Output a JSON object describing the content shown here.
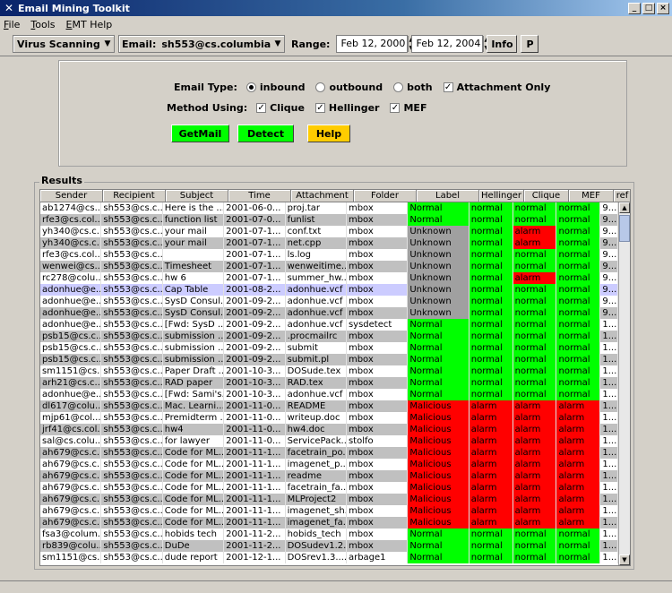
{
  "window": {
    "title": "Email Mining Toolkit"
  },
  "menu": [
    {
      "label": "File",
      "u": "F",
      "rest": "ile"
    },
    {
      "label": "Tools",
      "u": "T",
      "rest": "ools"
    },
    {
      "label": "EMT Help",
      "u": "E",
      "rest": "MT Help"
    }
  ],
  "toolbar": {
    "mode": "Virus Scanning",
    "email_label": "Email:",
    "email": "sh553@cs.columbia.edu",
    "range_label": "Range:",
    "range_start": "Feb 12, 2000",
    "range_end": "Feb 12, 2004",
    "info_label": "Info",
    "p_label": "P"
  },
  "controls": {
    "email_type_label": "Email Type:",
    "email_type_options": [
      {
        "label": "inbound",
        "selected": true
      },
      {
        "label": "outbound",
        "selected": false
      },
      {
        "label": "both",
        "selected": false
      }
    ],
    "attachment_only_label": "Attachment Only",
    "attachment_only": true,
    "method_label": "Method Using:",
    "methods": [
      {
        "label": "Clique",
        "checked": true
      },
      {
        "label": "Hellinger",
        "checked": true
      },
      {
        "label": "MEF",
        "checked": true
      }
    ],
    "getmail_label": "GetMail",
    "detect_label": "Detect",
    "help_label": "Help",
    "colors": {
      "getmail": "#00ff00",
      "detect": "#00ff00",
      "help": "#ffcc00"
    }
  },
  "results": {
    "label": "Results",
    "columns": [
      "Sender",
      "Recipient",
      "Subject",
      "Time",
      "Attachment",
      "Folder",
      "Label",
      "Hellinger",
      "Clique",
      "MEF",
      "ref"
    ],
    "rows": [
      [
        "ab1274@cs...",
        "sh553@cs.c...",
        "Here is the ...",
        "2001-06-0...",
        "proj.tar",
        "mbox",
        "Normal",
        "normal",
        "normal",
        "normal",
        "9..."
      ],
      [
        "rfe3@cs.col...",
        "sh553@cs.c...",
        "function list",
        "2001-07-0...",
        "funlist",
        "mbox",
        "Normal",
        "normal",
        "normal",
        "normal",
        "9..."
      ],
      [
        "yh340@cs.c...",
        "sh553@cs.c...",
        "your mail",
        "2001-07-1...",
        "conf.txt",
        "mbox",
        "Unknown",
        "normal",
        "alarm",
        "normal",
        "9..."
      ],
      [
        "yh340@cs.c...",
        "sh553@cs.c...",
        "your mail",
        "2001-07-1...",
        "net.cpp",
        "mbox",
        "Unknown",
        "normal",
        "alarm",
        "normal",
        "9..."
      ],
      [
        "rfe3@cs.col...",
        "sh553@cs.c...",
        "",
        "2001-07-1...",
        "ls.log",
        "mbox",
        "Unknown",
        "normal",
        "normal",
        "normal",
        "9..."
      ],
      [
        "wenwei@cs...",
        "sh553@cs.c...",
        "Timesheet",
        "2001-07-1...",
        "wenweitime...",
        "mbox",
        "Unknown",
        "normal",
        "normal",
        "normal",
        "9..."
      ],
      [
        "rc278@colu...",
        "sh553@cs.c...",
        "hw 6",
        "2001-07-1...",
        "summer_hw...",
        "mbox",
        "Unknown",
        "normal",
        "alarm",
        "normal",
        "9..."
      ],
      [
        "adonhue@e...",
        "sh553@cs.c...",
        "Cap Table",
        "2001-08-2...",
        "adonhue.vcf",
        "mbox",
        "Unknown",
        "normal",
        "normal",
        "normal",
        "9..."
      ],
      [
        "adonhue@e...",
        "sh553@cs.c...",
        "SysD Consul...",
        "2001-09-2...",
        "adonhue.vcf",
        "mbox",
        "Unknown",
        "normal",
        "normal",
        "normal",
        "9..."
      ],
      [
        "adonhue@e...",
        "sh553@cs.c...",
        "SysD Consul...",
        "2001-09-2...",
        "adonhue.vcf",
        "mbox",
        "Unknown",
        "normal",
        "normal",
        "normal",
        "9..."
      ],
      [
        "adonhue@e...",
        "sh553@cs.c...",
        "[Fwd: SysD ...",
        "2001-09-2...",
        "adonhue.vcf",
        "sysdetect",
        "Normal",
        "normal",
        "normal",
        "normal",
        "1..."
      ],
      [
        "psb15@cs.c...",
        "sh553@cs.c...",
        "submission ...",
        "2001-09-2...",
        ".procmailrc",
        "mbox",
        "Normal",
        "normal",
        "normal",
        "normal",
        "1..."
      ],
      [
        "psb15@cs.c...",
        "sh553@cs.c...",
        "submission ...",
        "2001-09-2...",
        "submit",
        "mbox",
        "Normal",
        "normal",
        "normal",
        "normal",
        "1..."
      ],
      [
        "psb15@cs.c...",
        "sh553@cs.c...",
        "submission ...",
        "2001-09-2...",
        "submit.pl",
        "mbox",
        "Normal",
        "normal",
        "normal",
        "normal",
        "1..."
      ],
      [
        "sm1151@cs...",
        "sh553@cs.c...",
        "Paper Draft ...",
        "2001-10-3...",
        "DOSude.tex",
        "mbox",
        "Normal",
        "normal",
        "normal",
        "normal",
        "1..."
      ],
      [
        "arh21@cs.c...",
        "sh553@cs.c...",
        "RAD paper",
        "2001-10-3...",
        "RAD.tex",
        "mbox",
        "Normal",
        "normal",
        "normal",
        "normal",
        "1..."
      ],
      [
        "adonhue@e...",
        "sh553@cs.c...",
        "[Fwd: Sami's...",
        "2001-10-3...",
        "adonhue.vcf",
        "mbox",
        "Normal",
        "normal",
        "normal",
        "normal",
        "1..."
      ],
      [
        "dl617@colu...",
        "sh553@cs.c...",
        "Mac. Learni...",
        "2001-11-0...",
        "README",
        "mbox",
        "Malicious",
        "alarm",
        "alarm",
        "alarm",
        "1..."
      ],
      [
        "mjp61@col...",
        "sh553@cs.c...",
        "Premidterm ...",
        "2001-11-0...",
        "writeup.doc",
        "mbox",
        "Malicious",
        "alarm",
        "alarm",
        "alarm",
        "1..."
      ],
      [
        "jrf41@cs.col...",
        "sh553@cs.c...",
        "hw4",
        "2001-11-0...",
        "hw4.doc",
        "mbox",
        "Malicious",
        "alarm",
        "alarm",
        "alarm",
        "1..."
      ],
      [
        "sal@cs.colu...",
        "sh553@cs.c...",
        "for lawyer",
        "2001-11-0...",
        "ServicePack...",
        "stolfo",
        "Malicious",
        "alarm",
        "alarm",
        "alarm",
        "1..."
      ],
      [
        "ah679@cs.c...",
        "sh553@cs.c...",
        "Code for ML...",
        "2001-11-1...",
        "facetrain_po...",
        "mbox",
        "Malicious",
        "alarm",
        "alarm",
        "alarm",
        "1..."
      ],
      [
        "ah679@cs.c...",
        "sh553@cs.c...",
        "Code for ML...",
        "2001-11-1...",
        "imagenet_p...",
        "mbox",
        "Malicious",
        "alarm",
        "alarm",
        "alarm",
        "1..."
      ],
      [
        "ah679@cs.c...",
        "sh553@cs.c...",
        "Code for ML...",
        "2001-11-1...",
        "readme",
        "mbox",
        "Malicious",
        "alarm",
        "alarm",
        "alarm",
        "1..."
      ],
      [
        "ah679@cs.c...",
        "sh553@cs.c...",
        "Code for ML...",
        "2001-11-1...",
        "facetrain_fa...",
        "mbox",
        "Malicious",
        "alarm",
        "alarm",
        "alarm",
        "1..."
      ],
      [
        "ah679@cs.c...",
        "sh553@cs.c...",
        "Code for ML...",
        "2001-11-1...",
        "MLProject2",
        "mbox",
        "Malicious",
        "alarm",
        "alarm",
        "alarm",
        "1..."
      ],
      [
        "ah679@cs.c...",
        "sh553@cs.c...",
        "Code for ML...",
        "2001-11-1...",
        "imagenet_sh...",
        "mbox",
        "Malicious",
        "alarm",
        "alarm",
        "alarm",
        "1..."
      ],
      [
        "ah679@cs.c...",
        "sh553@cs.c...",
        "Code for ML...",
        "2001-11-1...",
        "imagenet_fa...",
        "mbox",
        "Malicious",
        "alarm",
        "alarm",
        "alarm",
        "1..."
      ],
      [
        "fsa3@colum...",
        "sh553@cs.c...",
        "hobids tech",
        "2001-11-2...",
        "hobids_tech",
        "mbox",
        "Normal",
        "normal",
        "normal",
        "normal",
        "1..."
      ],
      [
        "rb839@colu...",
        "sh553@cs.c...",
        "DuDe",
        "2001-11-2...",
        "DOSudev1.2...",
        "mbox",
        "Normal",
        "normal",
        "normal",
        "normal",
        "1..."
      ],
      [
        "sm1151@cs...",
        "sh553@cs.c...",
        "dude report",
        "2001-12-1...",
        "DOSrev1.3....",
        "arbage1",
        "Normal",
        "normal",
        "normal",
        "normal",
        "1..."
      ]
    ],
    "selected_row": 7,
    "status_colors": {
      "Normal": "#00ff00",
      "normal": "#00ff00",
      "Unknown": "#a0a0a0",
      "Malicious": "#ff0000",
      "alarm": "#ff0000"
    }
  }
}
